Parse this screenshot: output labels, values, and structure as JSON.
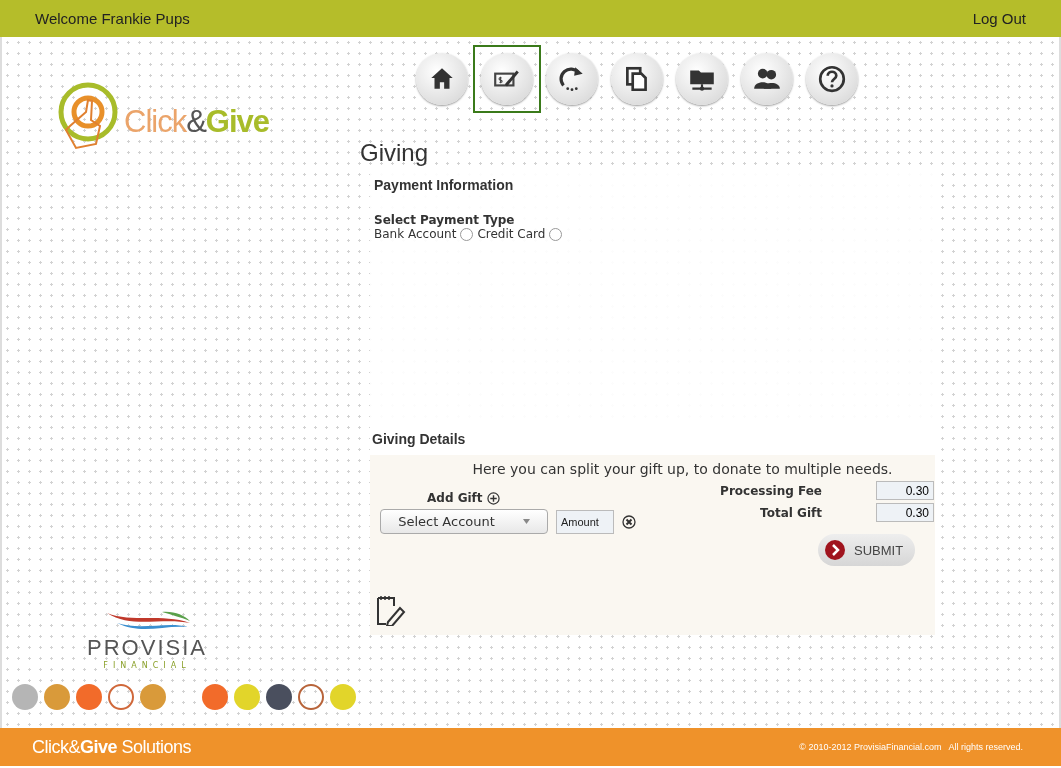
{
  "top_bar": {
    "welcome": "Welcome Frankie Pups",
    "logout": "Log Out"
  },
  "logo": {
    "parts": [
      "Click",
      "&",
      "Give"
    ]
  },
  "nav": [
    {
      "kind": "home",
      "selected": false
    },
    {
      "kind": "check",
      "selected": true
    },
    {
      "kind": "refresh",
      "selected": false
    },
    {
      "kind": "copy",
      "selected": false
    },
    {
      "kind": "folder",
      "selected": false
    },
    {
      "kind": "users",
      "selected": false
    },
    {
      "kind": "help",
      "selected": false
    }
  ],
  "page_title": "Giving",
  "payment": {
    "heading": "Payment Information",
    "subheading": "Select Payment Type",
    "options": [
      {
        "label": "Bank Account",
        "checked": false
      },
      {
        "label": "Credit Card",
        "checked": false
      }
    ]
  },
  "details": {
    "heading": "Giving Details",
    "intro": "Here you can split your gift up, to donate to multiple needs.",
    "add_gift": "Add Gift",
    "account": "Select Account",
    "amount_placeholder": "Amount",
    "fees": [
      {
        "label": "Processing Fee",
        "value": "0.30"
      },
      {
        "label": "Total Gift",
        "value": "0.30"
      }
    ],
    "submit": "SUBMIT"
  },
  "partner": {
    "name": "PROVISIA",
    "sub": "FINANCIAL"
  },
  "dots": [
    {
      "kind": "fill",
      "color": "#b5b5b5"
    },
    {
      "kind": "fill",
      "color": "#d99a3a"
    },
    {
      "kind": "fill",
      "color": "#f26b2a"
    },
    {
      "kind": "ring",
      "color": "#d0683a"
    },
    {
      "kind": "fill",
      "color": "#d99a3a"
    },
    {
      "kind": "gap"
    },
    {
      "kind": "fill",
      "color": "#f26b2a"
    },
    {
      "kind": "fill",
      "color": "#e2d52a"
    },
    {
      "kind": "fill",
      "color": "#4a4f5e"
    },
    {
      "kind": "ring",
      "color": "#b8643a"
    },
    {
      "kind": "fill",
      "color": "#e2d52a"
    }
  ],
  "footer": {
    "brand": "Click&**Give** Solutions",
    "copyright": "© 2010-2012 ProvisiaFinancial.com   All rights reserved."
  }
}
